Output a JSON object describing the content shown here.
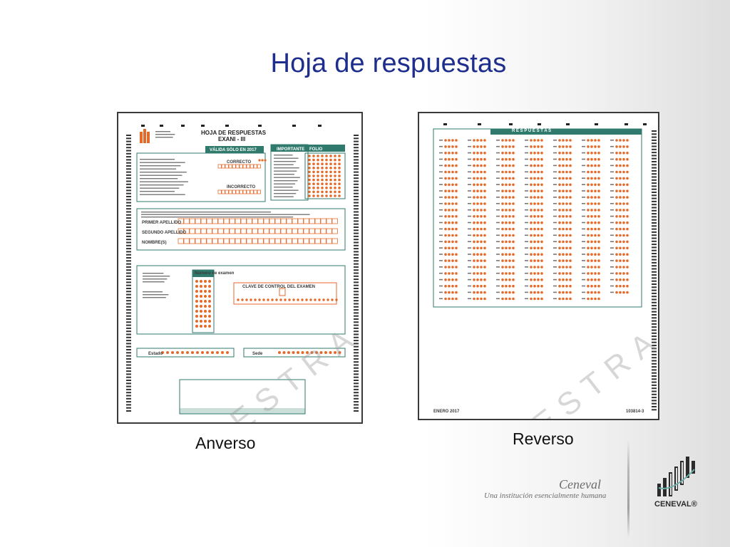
{
  "slide": {
    "title": "Hoja de respuestas"
  },
  "front": {
    "label": "Anverso",
    "watermark": "MUESTRA",
    "heading": "HOJA DE RESPUESTAS",
    "exam": "EXANI - III",
    "validity": "VÁLIDA SÓLO EN 2017",
    "box_important": "IMPORTANTE",
    "box_folio": "FOLIO",
    "correct_label": "CORRECTO",
    "incorrect_label": "INCORRECTO",
    "field_last1": "PRIMER APELLIDO",
    "field_last2": "SEGUNDO APELLIDO",
    "field_names": "NOMBRE(S)",
    "exam_number_label": "Número de examen",
    "control_key_label": "CLAVE DE CONTROL DEL EXAMEN",
    "state_label": "Estado",
    "location_label": "Sede"
  },
  "back": {
    "label": "Reverso",
    "watermark": "MUESTRA",
    "header": "R E S P U E S T A S",
    "footer_left": "ENERO 2017",
    "footer_right": "103814-3"
  },
  "brand": {
    "name": "Ceneval",
    "tagline": "Una institución esencialmente humana",
    "logo_text": "CENEVAL®"
  },
  "colors": {
    "title": "#1d2e8c",
    "form_green": "#2f7a6c",
    "bubble_orange": "#e46a2a"
  }
}
